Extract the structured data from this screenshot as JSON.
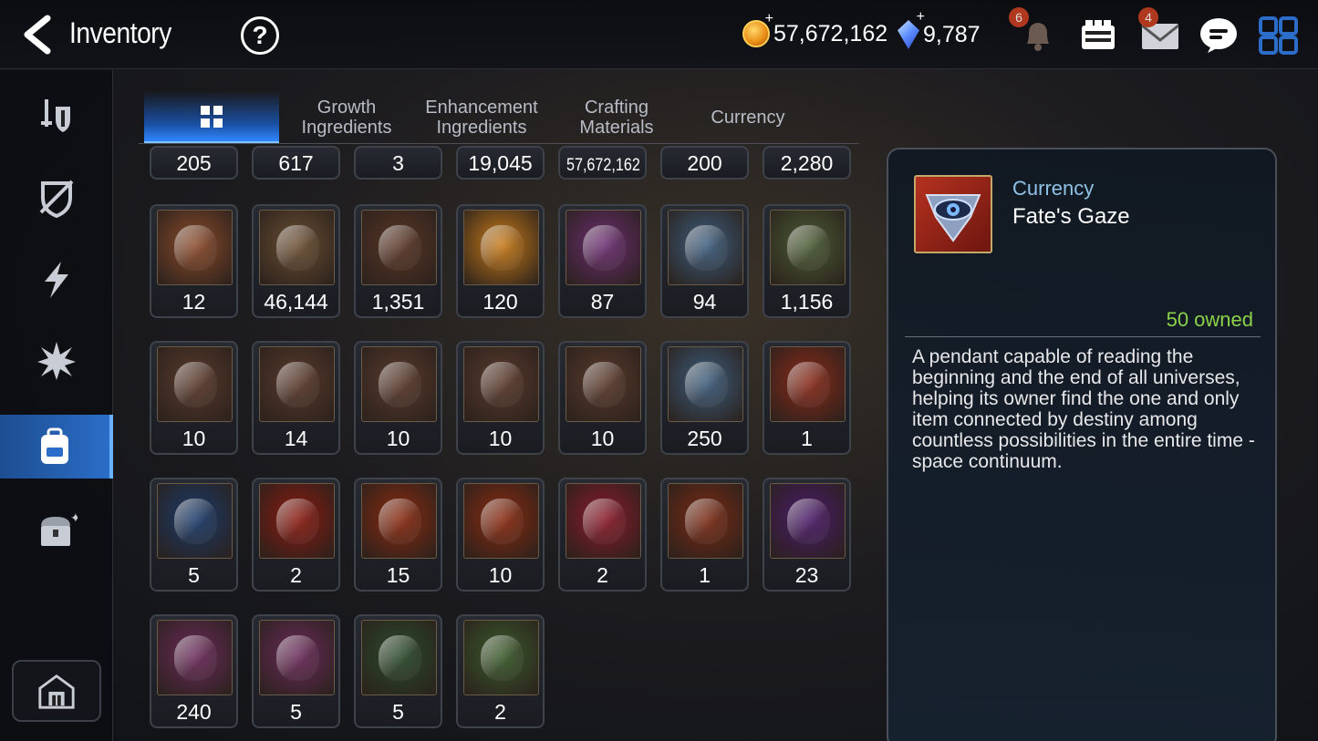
{
  "header": {
    "title": "Inventory",
    "gold": "57,672,162",
    "gems": "9,787",
    "notif_badge": "6",
    "mail_badge": "4"
  },
  "tabs": [
    {
      "label": "",
      "icon": "grid-icon",
      "active": true
    },
    {
      "label": "Growth\nIngredients"
    },
    {
      "label": "Enhancement\nIngredients"
    },
    {
      "label": "Crafting\nMaterials"
    },
    {
      "label": "Currency"
    }
  ],
  "sidebar": [
    "equipment-icon",
    "shield-icon",
    "lightning-icon",
    "burst-icon",
    "backpack-icon",
    "chest-icon"
  ],
  "items_top_row": [
    "205",
    "617",
    "3",
    "19,045",
    "57,672,162",
    "200",
    "2,280"
  ],
  "items": [
    {
      "count": "12",
      "icon": "banner-icon",
      "color": "#8a4a2a"
    },
    {
      "count": "46,144",
      "icon": "horse-icon",
      "color": "#6a4e32"
    },
    {
      "count": "1,351",
      "icon": "leaf-icon",
      "color": "#5a3626"
    },
    {
      "count": "120",
      "icon": "mascot-icon",
      "color": "#c77a18"
    },
    {
      "count": "87",
      "icon": "purple-flower-icon",
      "color": "#6a2c70"
    },
    {
      "count": "94",
      "icon": "gold-flower-icon",
      "color": "#3c5c7c"
    },
    {
      "count": "1,156",
      "icon": "silver-flower-icon",
      "color": "#4a5c34"
    },
    {
      "count": "10",
      "icon": "pink-rune-icon",
      "color": "#5a3a2c"
    },
    {
      "count": "14",
      "icon": "red-rune-icon",
      "color": "#5a3a2c"
    },
    {
      "count": "10",
      "icon": "blue-rune-icon",
      "color": "#5a3a2c"
    },
    {
      "count": "10",
      "icon": "yellow-rune-icon",
      "color": "#5a3a2c"
    },
    {
      "count": "10",
      "icon": "green-rune-icon",
      "color": "#5a3a2c"
    },
    {
      "count": "250",
      "icon": "root-icon",
      "color": "#3c5c7c"
    },
    {
      "count": "1",
      "icon": "green-orb-icon",
      "color": "#8a2a1a"
    },
    {
      "count": "5",
      "icon": "blue-circle-icon",
      "color": "#1a3a6a"
    },
    {
      "count": "2",
      "icon": "red-star-stone-icon",
      "color": "#8a1a10"
    },
    {
      "count": "15",
      "icon": "red-hammer-stone-icon",
      "color": "#8a2a10"
    },
    {
      "count": "10",
      "icon": "red-bolt-stone-icon",
      "color": "#8a2a10"
    },
    {
      "count": "2",
      "icon": "pink-potion-icon",
      "color": "#8a1a2a"
    },
    {
      "count": "1",
      "icon": "blue-hammer-icon",
      "color": "#7a2a14"
    },
    {
      "count": "23",
      "icon": "purple-star-stone-icon",
      "color": "#4a1a6a"
    },
    {
      "count": "240",
      "icon": "pink-hammer-stone-icon",
      "color": "#6a2a5a"
    },
    {
      "count": "5",
      "icon": "pink-bolt-stone-icon",
      "color": "#6a2a5a"
    },
    {
      "count": "5",
      "icon": "green-star-stone-icon",
      "color": "#2a4a2a"
    },
    {
      "count": "2",
      "icon": "green-hammer-stone-icon",
      "color": "#3a5a2a"
    }
  ],
  "detail": {
    "category": "Currency",
    "name": "Fate's Gaze",
    "owned": "50 owned",
    "description": "A pendant capable of reading the beginning and the end of all universes, helping its owner find the one and only item connected by destiny among countless possibilities in the entire time -space continuum."
  }
}
